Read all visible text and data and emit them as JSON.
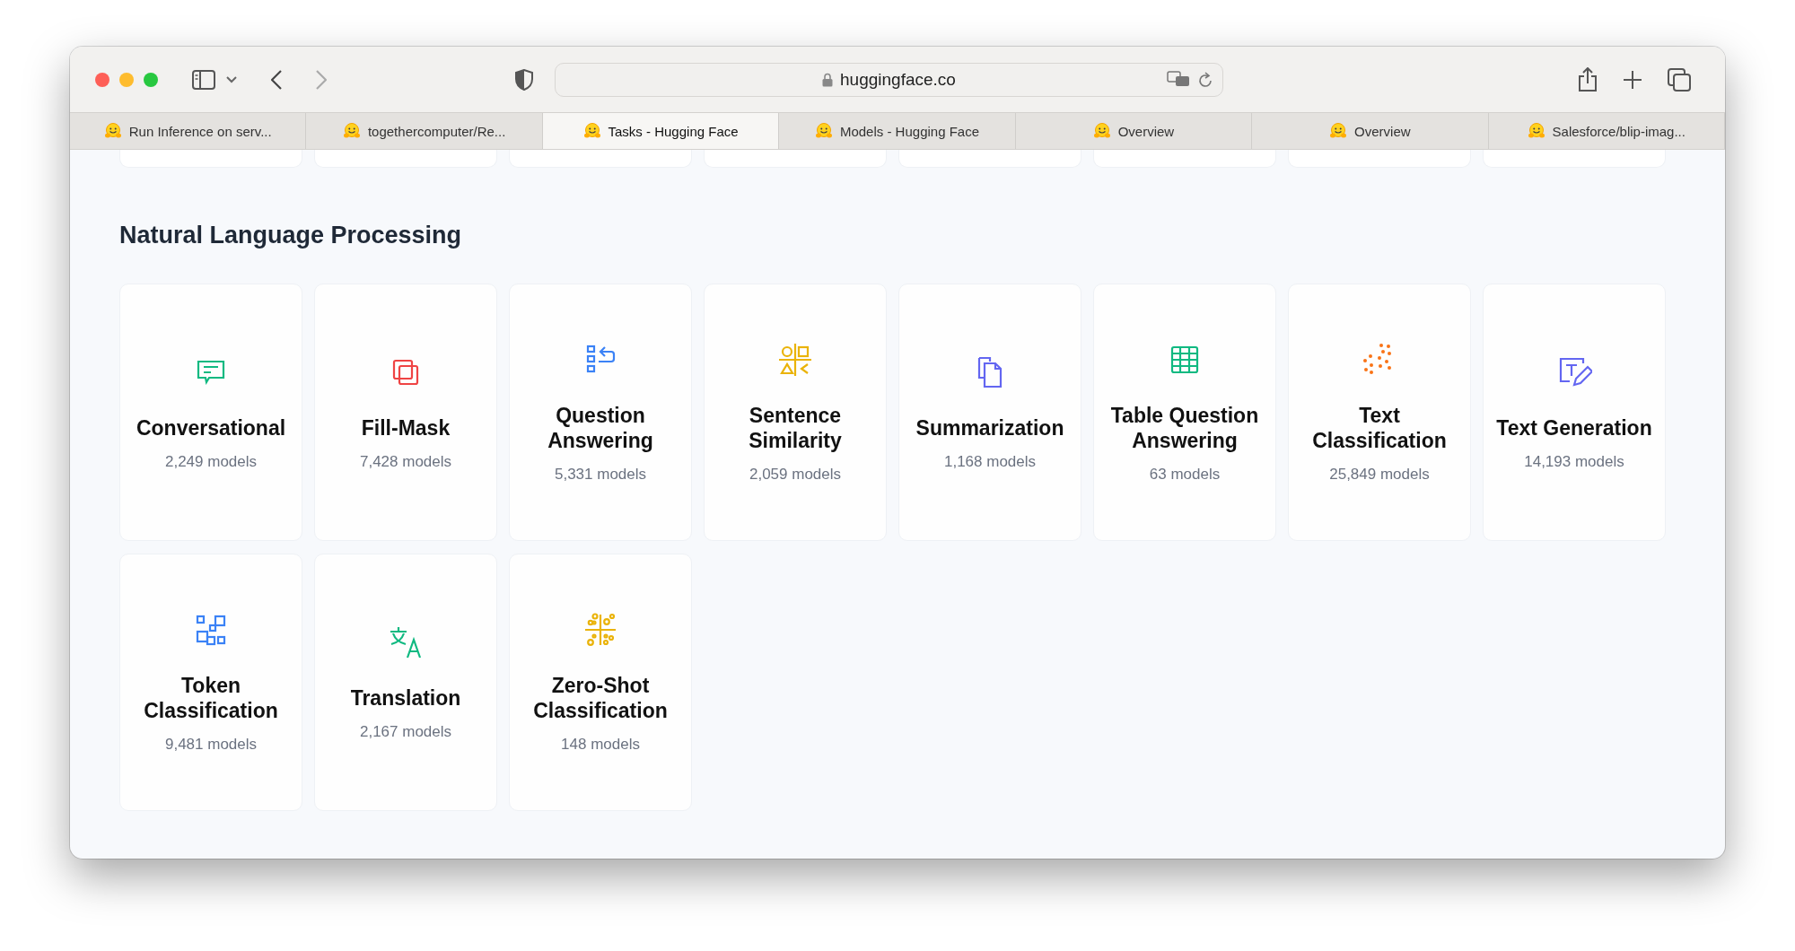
{
  "browser": {
    "address": "huggingface.co"
  },
  "tabs": [
    {
      "label": "Run Inference on serv...",
      "selected": false
    },
    {
      "label": "togethercomputer/Re...",
      "selected": false
    },
    {
      "label": "Tasks - Hugging Face",
      "selected": true
    },
    {
      "label": "Models - Hugging Face",
      "selected": false
    },
    {
      "label": "Overview",
      "selected": false
    },
    {
      "label": "Overview",
      "selected": false
    },
    {
      "label": "Salesforce/blip-imag...",
      "selected": false
    }
  ],
  "section": {
    "title": "Natural Language Processing"
  },
  "tasks": [
    {
      "kind": "chat",
      "color": "#10b981",
      "title": "Conversational",
      "count": "2,249 models"
    },
    {
      "kind": "mask",
      "color": "#ef4444",
      "title": "Fill-Mask",
      "count": "7,428 models"
    },
    {
      "kind": "qa",
      "color": "#3b82f6",
      "title": "Question Answering",
      "count": "5,331 models"
    },
    {
      "kind": "similarity",
      "color": "#eab308",
      "title": "Sentence Similarity",
      "count": "2,059 models"
    },
    {
      "kind": "docs",
      "color": "#6366f1",
      "title": "Summarization",
      "count": "1,168 models"
    },
    {
      "kind": "table",
      "color": "#10b981",
      "title": "Table Question Answering",
      "count": "63 models"
    },
    {
      "kind": "dots",
      "color": "#f97316",
      "title": "Text Classification",
      "count": "25,849 models"
    },
    {
      "kind": "textedit",
      "color": "#6366f1",
      "title": "Text Generation",
      "count": "14,193 models"
    },
    {
      "kind": "tokens",
      "color": "#3b82f6",
      "title": "Token Classification",
      "count": "9,481 models"
    },
    {
      "kind": "translate",
      "color": "#10b981",
      "title": "Translation",
      "count": "2,167 models"
    },
    {
      "kind": "zeroshot",
      "color": "#eab308",
      "title": "Zero-Shot Classification",
      "count": "148 models"
    }
  ]
}
